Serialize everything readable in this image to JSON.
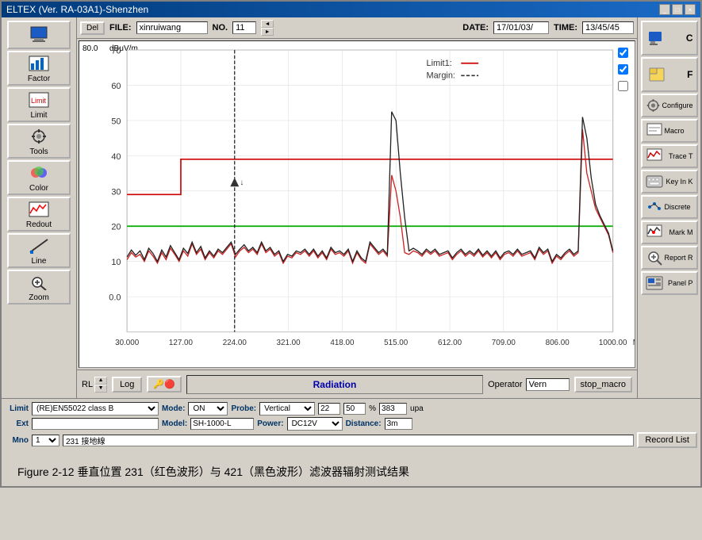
{
  "window": {
    "title": "ELTEX (Ver. RA-03A1)-Shenzhen",
    "title_buttons": [
      "_",
      "□",
      "×"
    ]
  },
  "top_bar": {
    "del_label": "Del",
    "file_label": "FILE:",
    "file_value": "xinruiwang",
    "no_label": "NO.",
    "no_value": "11",
    "date_label": "DATE:",
    "date_value": "17/01/03/",
    "time_label": "TIME:",
    "time_value": "13/45/45"
  },
  "chart": {
    "y_unit": "dBμV/m",
    "y_max": "80.0",
    "y_ticks": [
      "70",
      "60",
      "50",
      "40",
      "30",
      "20",
      "10",
      "0.0"
    ],
    "x_ticks": [
      "30.000",
      "127.00",
      "224.00",
      "321.00",
      "418.00",
      "515.00",
      "612.00",
      "709.00",
      "806.00",
      "1000.00"
    ],
    "x_unit": "MHz",
    "legend": {
      "limit_label": "Limit1:",
      "margin_label": "Margin:"
    }
  },
  "bottom_status": {
    "rl_label": "RL",
    "log_label": "Log",
    "radiation_text": "Radiation",
    "operator_label": "Operator",
    "operator_value": "Vern",
    "stop_macro_label": "stop_macro"
  },
  "left_toolbar": {
    "buttons": [
      {
        "label": "Factor",
        "icon": "📊"
      },
      {
        "label": "Limit",
        "icon": "📏"
      },
      {
        "label": "Tools",
        "icon": "🔧"
      },
      {
        "label": "Color",
        "icon": "🎨"
      },
      {
        "label": "Redout",
        "icon": "📈"
      },
      {
        "label": "Line",
        "icon": "✏️"
      },
      {
        "label": "Zoom",
        "icon": "🔍"
      }
    ]
  },
  "right_toolbar": {
    "buttons": [
      {
        "label": "C",
        "icon": "⚙"
      },
      {
        "label": "F",
        "icon": "📁"
      },
      {
        "label": "Configure",
        "icon": "⚙"
      },
      {
        "label": "Macro",
        "icon": "📋"
      },
      {
        "label": "Trace T",
        "icon": "📉"
      },
      {
        "label": "Key In K",
        "icon": "⌨"
      },
      {
        "label": "Discrete",
        "icon": "📌"
      },
      {
        "label": "Mark M",
        "icon": "📍"
      },
      {
        "label": "Report R",
        "icon": "🔎"
      },
      {
        "label": "Panel P",
        "icon": "🖥"
      }
    ]
  },
  "params": {
    "limit_label": "Limit",
    "limit_value": "(RE)EN55022 class B",
    "mode_label": "Mode:",
    "mode_value": "ON",
    "probe_label": "Probe:",
    "probe_value": "Vertical",
    "num1_value": "22",
    "num2_value": "50",
    "num3_value": "383",
    "unit_label": "upa",
    "ext_label": "Ext",
    "model_label": "Model:",
    "model_value": "SH-1000-L",
    "power_label": "Power:",
    "power_value": "DC12V",
    "distance_label": "Distance:",
    "distance_value": "3m",
    "memo_label": "Mno",
    "memo_num": "1",
    "memo_text": "231 接地線",
    "record_list_label": "Record List"
  },
  "figure": {
    "caption": "Figure 2-12  垂直位置 231（红色波形）与 421（黑色波形）滤波器辐射测试结果"
  }
}
